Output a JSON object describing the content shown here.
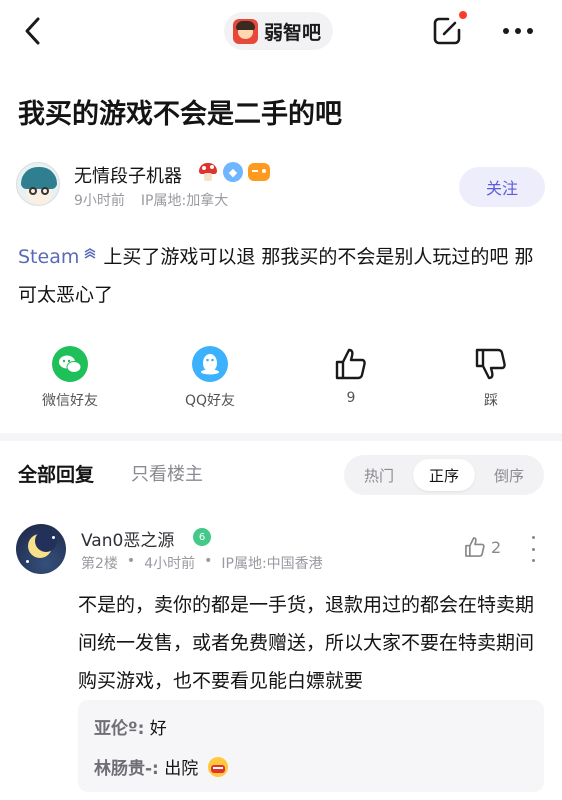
{
  "header": {
    "forum_name": "弱智吧",
    "icons": {
      "back": "chevron-left-icon",
      "edit": "edit-icon",
      "more": "more-horizontal-icon"
    },
    "notification_dot_color": "#ff3b30"
  },
  "post": {
    "title": "我买的游戏不会是二手的吧",
    "author": {
      "name": "无情段子机器",
      "time": "9小时前",
      "ip": "IP属地:加拿大",
      "badges": [
        "mushroom-badge-icon",
        "diamond-badge-icon",
        "gamepad-badge-icon"
      ]
    },
    "follow_label": "关注",
    "tag": "Steam",
    "body": "上买了游戏可以退 那我买的不会是别人玩过的吧 那可太恶心了"
  },
  "actions": {
    "wechat": "微信好友",
    "qq": "QQ好友",
    "like_count": "9",
    "dislike": "踩"
  },
  "replies": {
    "tab_all": "全部回复",
    "tab_owner": "只看楼主",
    "sort_options": [
      "热门",
      "正序",
      "倒序"
    ],
    "sort_selected": "正序"
  },
  "comment": {
    "name": "Van0恶之源",
    "level": "6",
    "floor": "第2楼",
    "time": "4小时前",
    "ip": "IP属地:中国香港",
    "like_count": "2",
    "body": "不是的，卖你的都是一手货，退款用过的都会在特卖期间统一发售，或者免费赠送，所以大家不要在特卖期间购买游戏，也不要看见能白嫖就要",
    "sub_replies": [
      {
        "who": "亚伦º:",
        "text": "好"
      },
      {
        "who": "林肠贵-:",
        "text": "出院"
      }
    ]
  },
  "colors": {
    "accent": "#5b5bdc",
    "follow_bg": "#ededfb",
    "steam_tag": "#5b6ab8",
    "wechat": "#1fbf5a",
    "qq": "#3cb2ff",
    "level_badge": "#44c98b"
  }
}
